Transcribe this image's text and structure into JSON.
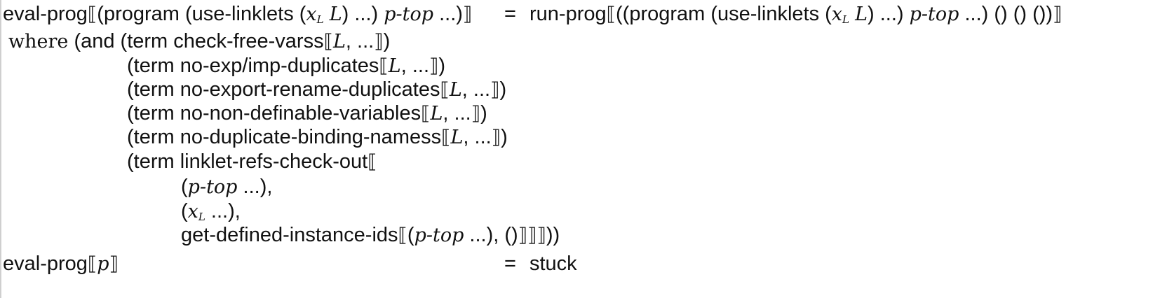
{
  "rule1": {
    "lhs_fn": "eval-prog",
    "lhs_pre": "(program (use-linklets (",
    "x": "x",
    "x_sub": "L",
    "L": "L",
    "lhs_mid": ") ...) ",
    "ptop": "p-top",
    "lhs_end": " ...)",
    "eq": "=",
    "rhs_fn": "run-prog",
    "rhs_pre": "((program (use-linklets (",
    "rhs_mid": ") ...) ",
    "rhs_end": " ...) () () ())"
  },
  "where_kw": "where",
  "cond": {
    "c1_pre": "(and (term check-free-varss",
    "c2_pre": "(term no-exp/imp-duplicates",
    "c3_pre": "(term no-export-rename-duplicates",
    "c4_pre": "(term no-non-definable-variables",
    "c5_pre": "(term no-duplicate-binding-namess",
    "c6_pre": "(term linklet-refs-check-out",
    "L": "L",
    "dots_close": ", ...",
    "close1": ")",
    "a1_open": "(",
    "a1_var": "p-top",
    "a1_close": " ...),",
    "a2_open": "(",
    "a2_var": "x",
    "a2_sub": "L",
    "a2_close": " ...),",
    "a3_pre": "get-defined-instance-ids",
    "a3_open": "(",
    "a3_var": "p-top",
    "a3_mid": " ...), ()",
    "a3_end": "))"
  },
  "rule2": {
    "lhs_fn": "eval-prog",
    "p": "p",
    "eq": "=",
    "rhs": "stuck"
  },
  "symbols": {
    "lbr": "⟦",
    "rbr": "⟧"
  }
}
